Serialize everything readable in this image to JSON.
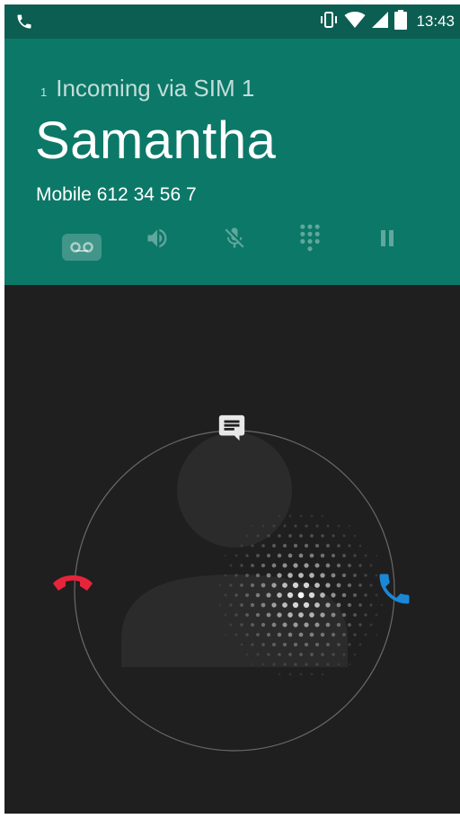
{
  "status_bar": {
    "time": "13:43",
    "icons": [
      "phone-icon",
      "vibrate-icon",
      "wifi-icon",
      "signal-icon",
      "battery-icon"
    ]
  },
  "header": {
    "sim_index": "1",
    "sim_label": "Incoming via SIM 1",
    "caller_name": "Samantha",
    "caller_number": "Mobile 612 34 56 7"
  },
  "controls": {
    "items": [
      "voicemail-icon",
      "speaker-icon",
      "mute-icon",
      "dialpad-icon",
      "hold-icon"
    ]
  },
  "call_targets": {
    "message": "message-icon",
    "decline": "decline-call-icon",
    "answer": "answer-call-icon"
  },
  "colors": {
    "status_bar_bg": "#0b5e51",
    "header_bg": "#0c7868",
    "call_bg": "#1f1f1f",
    "decline": "#e8243a",
    "answer": "#1a88d6"
  }
}
